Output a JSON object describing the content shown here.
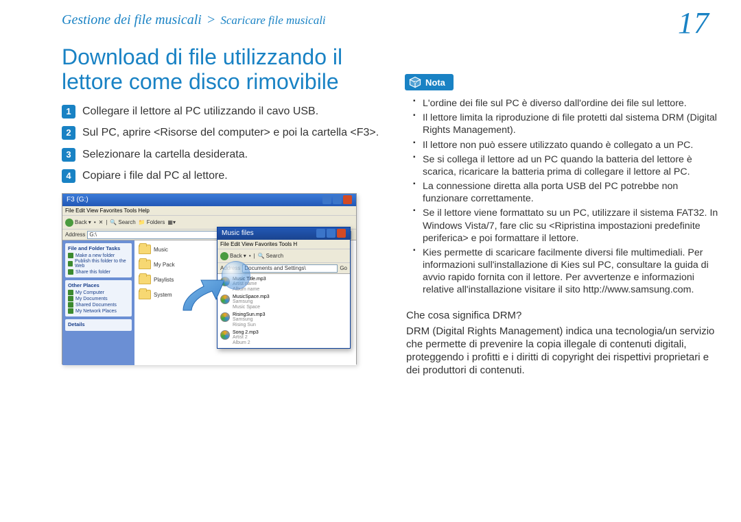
{
  "breadcrumb": {
    "first": "Gestione dei file musicali",
    "sep": ">",
    "second": "Scaricare file musicali"
  },
  "page_number": "17",
  "title": "Download di file utilizzando il lettore come disco rimovibile",
  "steps": [
    "Collegare il lettore al PC utilizzando il cavo USB.",
    "Sul PC, aprire <Risorse del computer> e poi la cartella <F3>.",
    "Selezionare la cartella desiderata.",
    "Copiare i file dal PC al lettore."
  ],
  "screenshot": {
    "window_title": "F3 (G:)",
    "menu_items": "File   Edit   View   Favorites   Tools   Help",
    "toolbar": {
      "back": "Back",
      "search": "Search",
      "folders": "Folders"
    },
    "address_label": "Address",
    "address_value": "G:\\",
    "side_panels": [
      {
        "header": "File and Folder Tasks",
        "items": [
          "Make a new folder",
          "Publish this folder to the Web",
          "Share this folder"
        ]
      },
      {
        "header": "Other Places",
        "items": [
          "My Computer",
          "My Documents",
          "Shared Documents",
          "My Network Places"
        ]
      },
      {
        "header": "Details",
        "items": []
      }
    ],
    "folders": [
      "Music",
      "My Pack",
      "Playlists",
      "System"
    ],
    "sub_window": {
      "title": "Music files",
      "menu": "File   Edit   View   Favorites   Tools   H",
      "toolbar": {
        "back": "Back",
        "search": "Search"
      },
      "address_label": "Address",
      "address_value": "Documents and Settings\\",
      "go": "Go",
      "files": [
        {
          "name": "Music Title.mp3",
          "line2": "Artist name",
          "line3": "Album name"
        },
        {
          "name": "MusicSpace.mp3",
          "line2": "Samsung",
          "line3": "Music Space"
        },
        {
          "name": "RisingSun.mp3",
          "line2": "Samsung",
          "line3": "Rising Sun"
        },
        {
          "name": "Song 2.mp3",
          "line2": "Artist 2",
          "line3": "Album 2"
        }
      ]
    }
  },
  "nota_label": "Nota",
  "notes": [
    "L'ordine dei file sul PC è diverso dall'ordine dei file sul lettore.",
    "Il lettore limita la riproduzione di file protetti dal sistema DRM (Digital Rights Management).",
    "Il lettore non può essere utilizzato quando è collegato a un PC.",
    "Se si collega il lettore ad un PC quando la batteria del lettore è scarica, ricaricare la batteria prima di collegare il lettore al PC.",
    "La connessione diretta alla porta USB del PC potrebbe non funzionare correttamente.",
    "Se il lettore viene formattato su un PC, utilizzare il sistema FAT32. In Windows Vista/7, fare clic su <Ripristina impostazioni predefinite periferica> e poi formattare il lettore.",
    "Kies permette di scaricare facilmente diversi file multimediali. Per informazioni sull'installazione di Kies sul PC, consultare la guida di avvio rapido fornita con il lettore. Per avvertenze e informazioni relative all'installazione visitare il sito http://www.samsung.com."
  ],
  "drm": {
    "question": "Che cosa significa DRM?",
    "answer": "DRM (Digital Rights Management) indica una tecnologia/un servizio che permette di prevenire la copia illegale di contenuti digitali, proteggendo i profitti e i diritti di copyright dei rispettivi proprietari e dei produttori di contenuti."
  }
}
